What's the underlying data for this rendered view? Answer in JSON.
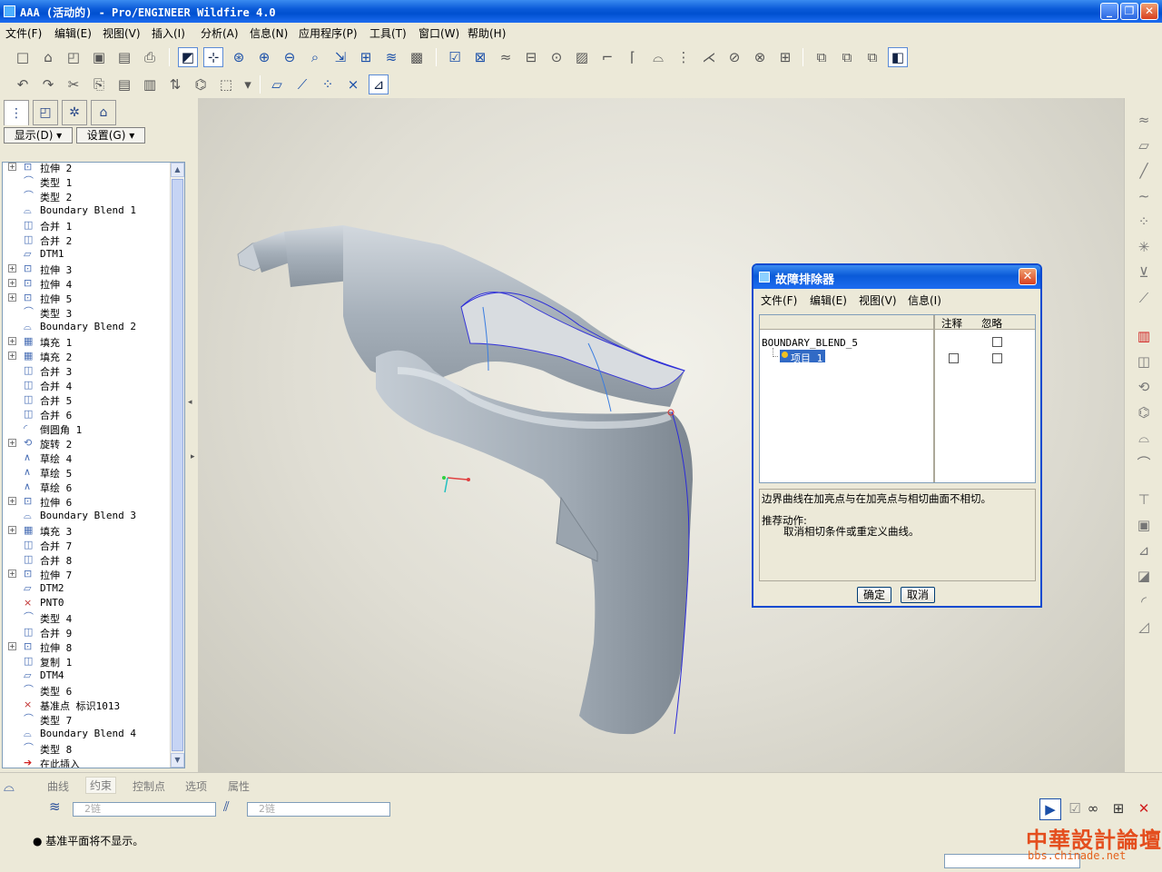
{
  "window": {
    "title": "AAA (活动的) - Pro/ENGINEER Wildfire 4.0",
    "minimize": "_",
    "restore": "❐",
    "close": "✕"
  },
  "menu": [
    "文件(F)",
    "编辑(E)",
    "视图(V)",
    "插入(I)",
    "分析(A)",
    "信息(N)",
    "应用程序(P)",
    "工具(T)",
    "窗口(W)",
    "帮助(H)"
  ],
  "left_panel": {
    "show_button": "显示(D) ▾",
    "settings_button": "设置(G) ▾",
    "tree": [
      {
        "label": "拉伸 2",
        "icon": "extrude-icon",
        "glyph": "⊡",
        "expandable": true
      },
      {
        "label": "类型 1",
        "icon": "surface-icon",
        "glyph": "⌒",
        "expandable": false
      },
      {
        "label": "类型 2",
        "icon": "surface-icon",
        "glyph": "⌒",
        "expandable": false
      },
      {
        "label": "Boundary Blend 1",
        "icon": "boundary-blend-icon",
        "glyph": "⌓",
        "expandable": false
      },
      {
        "label": "合并 1",
        "icon": "merge-icon",
        "glyph": "◫",
        "expandable": false
      },
      {
        "label": "合并 2",
        "icon": "merge-icon",
        "glyph": "◫",
        "expandable": false
      },
      {
        "label": "DTM1",
        "icon": "datum-plane-icon",
        "glyph": "▱",
        "expandable": false
      },
      {
        "label": "拉伸 3",
        "icon": "extrude-icon",
        "glyph": "⊡",
        "expandable": true
      },
      {
        "label": "拉伸 4",
        "icon": "extrude-icon",
        "glyph": "⊡",
        "expandable": true
      },
      {
        "label": "拉伸 5",
        "icon": "extrude-icon",
        "glyph": "⊡",
        "expandable": true
      },
      {
        "label": "类型 3",
        "icon": "surface-icon",
        "glyph": "⌒",
        "expandable": false
      },
      {
        "label": "Boundary Blend 2",
        "icon": "boundary-blend-icon",
        "glyph": "⌓",
        "expandable": false
      },
      {
        "label": "填充 1",
        "icon": "fill-icon",
        "glyph": "▦",
        "expandable": true
      },
      {
        "label": "填充 2",
        "icon": "fill-icon",
        "glyph": "▦",
        "expandable": true
      },
      {
        "label": "合并 3",
        "icon": "merge-icon",
        "glyph": "◫",
        "expandable": false
      },
      {
        "label": "合并 4",
        "icon": "merge-icon",
        "glyph": "◫",
        "expandable": false
      },
      {
        "label": "合并 5",
        "icon": "merge-icon",
        "glyph": "◫",
        "expandable": false
      },
      {
        "label": "合并 6",
        "icon": "merge-icon",
        "glyph": "◫",
        "expandable": false
      },
      {
        "label": "倒圆角 1",
        "icon": "round-icon",
        "glyph": "◜",
        "expandable": false
      },
      {
        "label": "旋转 2",
        "icon": "revolve-icon",
        "glyph": "⟲",
        "expandable": true
      },
      {
        "label": "草绘 4",
        "icon": "sketch-icon",
        "glyph": "∧",
        "expandable": false
      },
      {
        "label": "草绘 5",
        "icon": "sketch-icon",
        "glyph": "∧",
        "expandable": false
      },
      {
        "label": "草绘 6",
        "icon": "sketch-icon",
        "glyph": "∧",
        "expandable": false
      },
      {
        "label": "拉伸 6",
        "icon": "extrude-icon",
        "glyph": "⊡",
        "expandable": true
      },
      {
        "label": "Boundary Blend 3",
        "icon": "boundary-blend-icon",
        "glyph": "⌓",
        "expandable": false
      },
      {
        "label": "填充 3",
        "icon": "fill-icon",
        "glyph": "▦",
        "expandable": true
      },
      {
        "label": "合并 7",
        "icon": "merge-icon",
        "glyph": "◫",
        "expandable": false
      },
      {
        "label": "合并 8",
        "icon": "merge-icon",
        "glyph": "◫",
        "expandable": false
      },
      {
        "label": "拉伸 7",
        "icon": "extrude-icon",
        "glyph": "⊡",
        "expandable": true
      },
      {
        "label": "DTM2",
        "icon": "datum-plane-icon",
        "glyph": "▱",
        "expandable": false
      },
      {
        "label": "PNT0",
        "icon": "datum-point-icon",
        "glyph": "×",
        "expandable": false
      },
      {
        "label": "类型 4",
        "icon": "surface-icon",
        "glyph": "⌒",
        "expandable": false
      },
      {
        "label": "合并 9",
        "icon": "merge-icon",
        "glyph": "◫",
        "expandable": false
      },
      {
        "label": "拉伸 8",
        "icon": "extrude-icon",
        "glyph": "⊡",
        "expandable": true
      },
      {
        "label": "复制 1",
        "icon": "copy-icon",
        "glyph": "◫",
        "expandable": false
      },
      {
        "label": "DTM4",
        "icon": "datum-plane-icon",
        "glyph": "▱",
        "expandable": false
      },
      {
        "label": "类型 6",
        "icon": "surface-icon",
        "glyph": "⌒",
        "expandable": false
      },
      {
        "label": "基准点 标识1013",
        "icon": "datum-point-icon",
        "glyph": "×",
        "expandable": false
      },
      {
        "label": "类型 7",
        "icon": "surface-icon",
        "glyph": "⌒",
        "expandable": false
      },
      {
        "label": "Boundary Blend 4",
        "icon": "boundary-blend-icon",
        "glyph": "⌓",
        "expandable": false
      },
      {
        "label": "类型 8",
        "icon": "surface-icon",
        "glyph": "⌒",
        "expandable": false
      },
      {
        "label": "在此插入",
        "icon": "insert-here-arrow-icon",
        "glyph": "➔",
        "expandable": false
      }
    ]
  },
  "dialog": {
    "title": "故障排除器",
    "menu": [
      "文件(F)",
      "编辑(E)",
      "视图(V)",
      "信息(I)"
    ],
    "col_note": "注释",
    "col_ignore": "忽略",
    "root_item": "BOUNDARY_BLEND_5",
    "child_item": "项目 1",
    "message": "边界曲线在加亮点与在加亮点与相切曲面不相切。",
    "recommend_label": "推荐动作:",
    "recommend_text": "取消相切条件或重定义曲线。",
    "ok": "确定",
    "cancel": "取消"
  },
  "dashboard": {
    "tabs": [
      "曲线",
      "约束",
      "控制点",
      "选项",
      "属性"
    ],
    "active_tab": "约束",
    "field1": "2链",
    "field2": "2链",
    "message": "● 基准平面将不显示。"
  },
  "watermark": {
    "line1": "中華設計論壇",
    "line2": "bbs.chinade.net"
  },
  "colors": {
    "title_bar": "#0a5ad8",
    "model_surface": "#a8b2bd",
    "edge_highlight": "#2b2bd8"
  }
}
